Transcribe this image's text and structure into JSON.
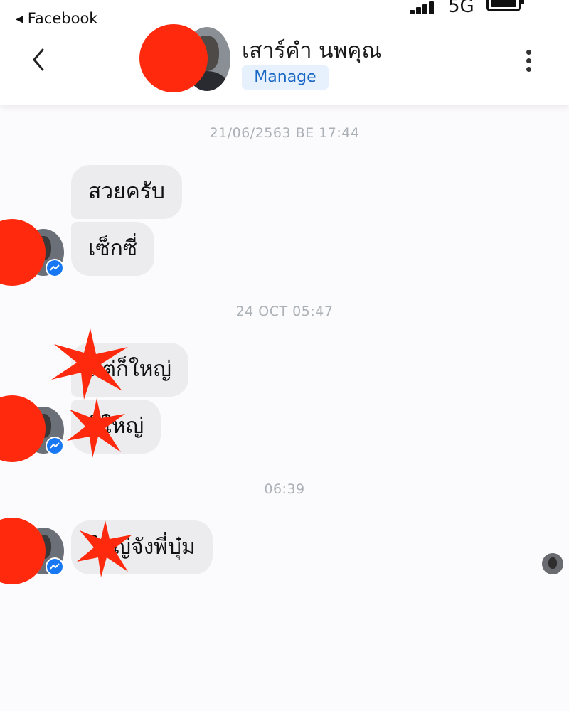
{
  "status_bar": {
    "back_app": "Facebook",
    "network": "5G"
  },
  "header": {
    "contact_name": "เสาร์คำ นพคุณ",
    "manage_label": "Manage"
  },
  "conversation": {
    "groups": [
      {
        "timestamp": "21/06/2563 BE 17:44",
        "messages": [
          "สวยครับ",
          "เซ็กซี่"
        ]
      },
      {
        "timestamp": "24 OCT 05:47",
        "messages": [
          "แต่ก็ใหญ่",
          "ก็ใหญ่"
        ]
      },
      {
        "timestamp": "06:39",
        "messages": [
          "ใหญ่จังพี่บุ๋ม"
        ]
      }
    ]
  },
  "colors": {
    "accent": "#1877f2",
    "redaction": "#ff2a0e",
    "bubble": "#ececee",
    "timestamp": "#aab0b6"
  },
  "icons": [
    "back-triangle-icon",
    "signal-icon",
    "battery-icon",
    "chevron-left-icon",
    "more-vertical-icon",
    "messenger-icon"
  ]
}
